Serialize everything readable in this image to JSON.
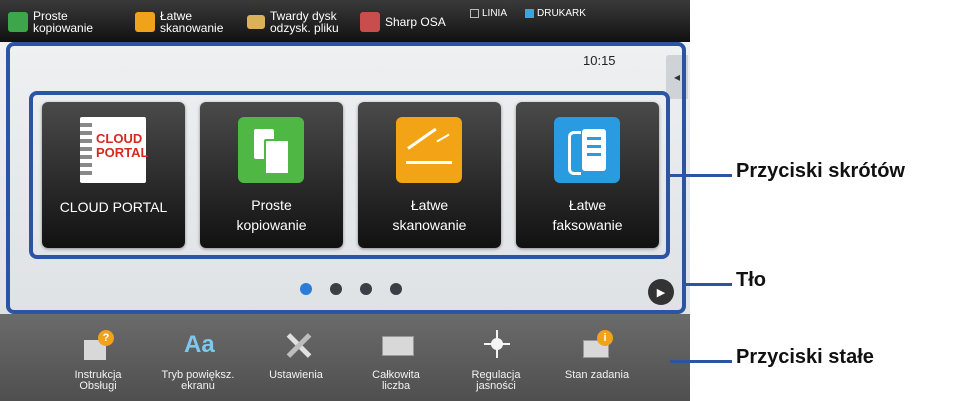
{
  "topbar": {
    "items": [
      {
        "label": "Proste\nkopiowanie",
        "icon": "copy-icon",
        "color": "#3ea64a"
      },
      {
        "label": "Łatwe\nskanowanie",
        "icon": "scan-icon",
        "color": "#f0a21a"
      },
      {
        "label": "Twardy dysk\nodzysk. pliku",
        "icon": "folder-icon",
        "color": "#d9b25a"
      },
      {
        "label": "Sharp OSA",
        "icon": "osa-icon",
        "color": "#c94d4d"
      }
    ],
    "status_linia": "LINIA",
    "status_drukark": "DRUKARK",
    "job_status": "Stan zadania"
  },
  "screen": {
    "clock": "10:15",
    "side_tab_glyph": "◂",
    "tiles": [
      {
        "label": "CLOUD PORTAL",
        "icon": "cloud-portal-icon",
        "logo_line1": "CLOUD",
        "logo_line2": "PORTAL"
      },
      {
        "label": "Proste\nkopiowanie",
        "icon": "copy-icon",
        "color": "#4fb844"
      },
      {
        "label": "Łatwe\nskanowanie",
        "icon": "scan-icon",
        "color": "#f3a316"
      },
      {
        "label": "Łatwe\nfaksowanie",
        "icon": "fax-icon",
        "color": "#2a9be0"
      }
    ],
    "page_indicator": {
      "pages": 4,
      "active": 1
    },
    "next_glyph": "▶"
  },
  "fixed_buttons": [
    {
      "label": "Instrukcja\nObsługi",
      "icon": "manual-help-icon"
    },
    {
      "label": "Tryb powiększ.\nekranu",
      "icon": "text-zoom-icon"
    },
    {
      "label": "Ustawienia",
      "icon": "settings-tools-icon"
    },
    {
      "label": "Całkowita\nliczba",
      "icon": "counter-icon"
    },
    {
      "label": "Regulacja\njasności",
      "icon": "brightness-icon"
    },
    {
      "label": "Stan zadania",
      "icon": "job-status-icon"
    }
  ],
  "callouts": {
    "shortcut_buttons": "Przyciski skrótów",
    "background": "Tło",
    "fixed_buttons": "Przyciski stałe"
  },
  "colors": {
    "frame": "#2b55a3",
    "accent": "#2b7cd8"
  }
}
